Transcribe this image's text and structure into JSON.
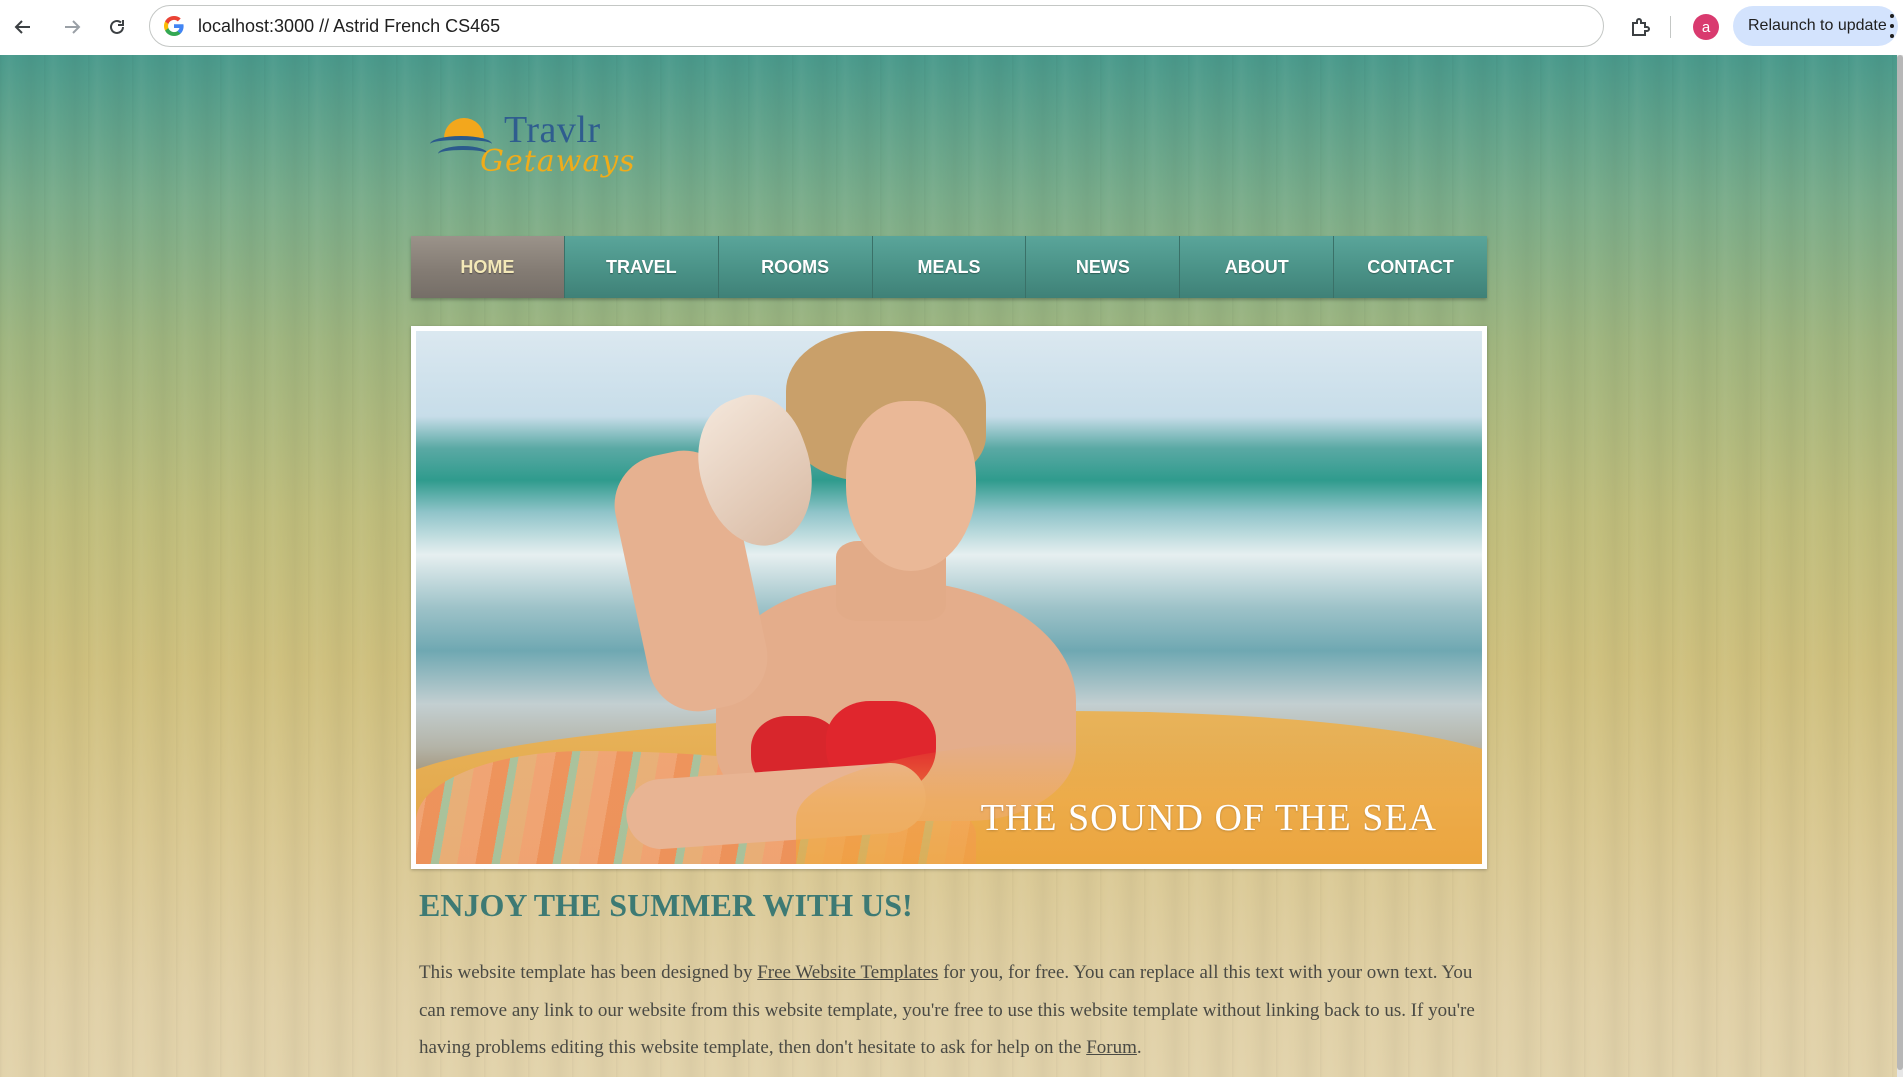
{
  "browser": {
    "url": "localhost:3000 // Astrid French CS465",
    "profile_initial": "a",
    "relaunch_label": "Relaunch to update",
    "colors": {
      "avatar": "#d93a6f",
      "relaunch_bg": "#d3e3fd"
    }
  },
  "site": {
    "logo": {
      "line1": "Travlr",
      "line2": "Getaways"
    },
    "nav": [
      {
        "label": "HOME",
        "active": true
      },
      {
        "label": "TRAVEL",
        "active": false
      },
      {
        "label": "ROOMS",
        "active": false
      },
      {
        "label": "MEALS",
        "active": false
      },
      {
        "label": "NEWS",
        "active": false
      },
      {
        "label": "ABOUT",
        "active": false
      },
      {
        "label": "CONTACT",
        "active": false
      }
    ],
    "hero": {
      "caption": "THE SOUND OF THE SEA"
    },
    "content": {
      "title": "ENJOY THE SUMMER WITH US!",
      "text1": "This website template has been designed by ",
      "link1": "Free Website Templates",
      "text2": " for you, for free. You can replace all this text with your own text. You can remove any link to our website from this website template, you're free to use this website template without linking back to us. If you're having problems editing this website template, then don't hesitate to ask for help on the ",
      "link2": "Forum",
      "text3": "."
    },
    "colors": {
      "nav_teal": "#4a9287",
      "nav_active": "#847c74",
      "heading": "#3d7a74",
      "logo_blue": "#2f5d8f",
      "logo_orange": "#f0ac1a"
    }
  }
}
